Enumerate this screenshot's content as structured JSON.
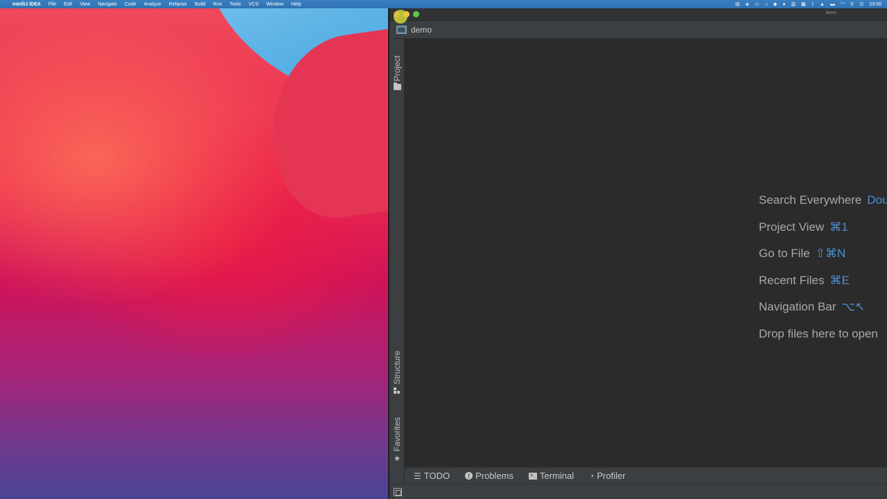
{
  "menubar": {
    "apple_icon": "apple-icon",
    "app_name": "IntelliJ IDEA",
    "items": [
      "File",
      "Edit",
      "View",
      "Navigate",
      "Code",
      "Analyze",
      "Refactor",
      "Build",
      "Run",
      "Tools",
      "VCS",
      "Window",
      "Help"
    ],
    "clock": "23:00"
  },
  "window": {
    "title": "demo",
    "project_name": "demo"
  },
  "left_tool_strip": {
    "project": "Project",
    "structure": "Structure",
    "favorites": "Favorites"
  },
  "editor_hints": [
    {
      "label": "Search Everywhere",
      "shortcut": "Dou"
    },
    {
      "label": "Project View",
      "shortcut": "⌘1"
    },
    {
      "label": "Go to File",
      "shortcut": "⇧⌘N"
    },
    {
      "label": "Recent Files",
      "shortcut": "⌘E"
    },
    {
      "label": "Navigation Bar",
      "shortcut": "⌥↖"
    },
    {
      "label": "Drop files here to open",
      "shortcut": ""
    }
  ],
  "bottom_tabs": {
    "todo": "TODO",
    "problems": "Problems",
    "terminal": "Terminal",
    "profiler": "Profiler"
  },
  "colors": {
    "menubar": "#2f72b4",
    "ide_background": "#2b2b2b",
    "panel": "#3c3f41",
    "shortcut_accent": "#4f90d0",
    "hint_text": "#a9a9a9"
  }
}
